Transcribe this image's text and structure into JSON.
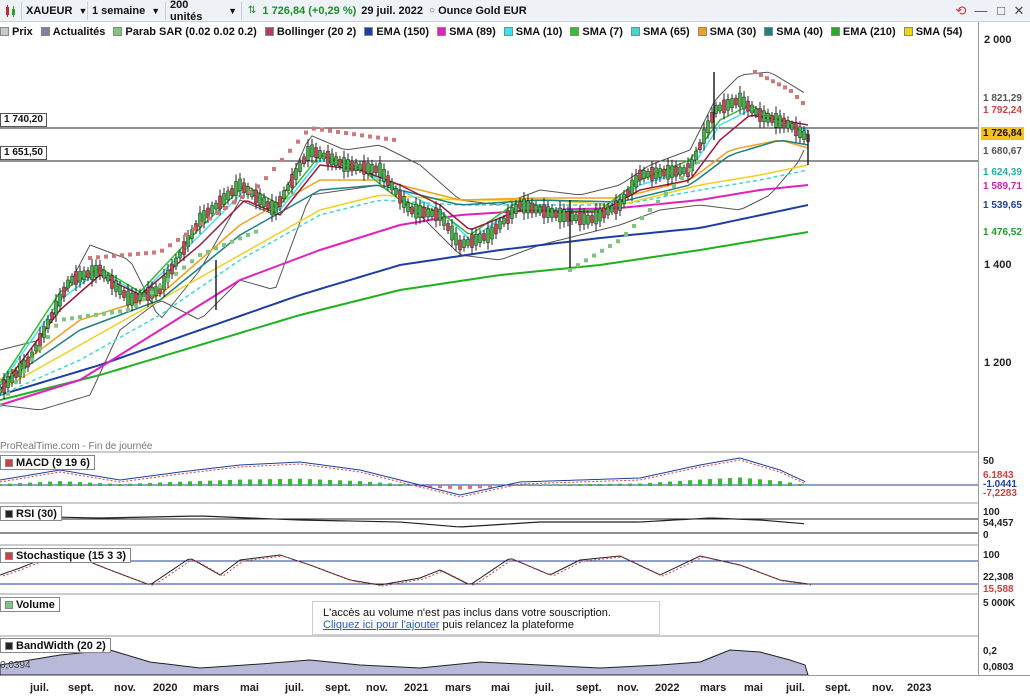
{
  "toolbar": {
    "symbol": "XAUEUR",
    "period": "1 semaine",
    "units": "200 unités",
    "price": "1 726,84 (+0,29 %)",
    "date": "29 juil. 2022",
    "instrument": "Ounce Gold EUR"
  },
  "legend": [
    {
      "label": "Prix",
      "color": "#c8c8c8"
    },
    {
      "label": "Actualités",
      "color": "#8080a0"
    },
    {
      "label": "Parab SAR (0.02 0.02 0.2)",
      "color": "#7fc47f"
    },
    {
      "label": "Bollinger (20 2)",
      "color": "#b04060"
    },
    {
      "label": "EMA (150)",
      "color": "#1f3fa0"
    },
    {
      "label": "SMA (89)",
      "color": "#e020c0"
    },
    {
      "label": "SMA (10)",
      "color": "#40e0f0"
    },
    {
      "label": "SMA (7)",
      "color": "#30c030"
    },
    {
      "label": "SMA (65)",
      "color": "#40d8d0"
    },
    {
      "label": "SMA (30)",
      "color": "#f0a020"
    },
    {
      "label": "SMA (40)",
      "color": "#208080"
    },
    {
      "label": "EMA (210)",
      "color": "#20b020"
    },
    {
      "label": "SMA (54)",
      "color": "#f0d020"
    }
  ],
  "price_axis": {
    "ticks": [
      "2 000",
      "1 400",
      "1 200"
    ],
    "flags": [
      {
        "text": "1 821,29",
        "color": "#555555"
      },
      {
        "text": "1 792,24",
        "color": "#d04040"
      },
      {
        "text": "1 726,84",
        "color": "#111111",
        "bg": "#f5c020"
      },
      {
        "text": "1 680,67",
        "color": "#555555"
      },
      {
        "text": "1 624,39",
        "color": "#20b0a0"
      },
      {
        "text": "1 589,71",
        "color": "#d020b0"
      },
      {
        "text": "1 539,65",
        "color": "#1f3fa0"
      },
      {
        "text": "1 476,52",
        "color": "#20a020"
      }
    ],
    "hlines": [
      "1 740,20",
      "1 651,50"
    ]
  },
  "watermark": "ProRealTime.com - Fin de journée",
  "panels": {
    "macd": {
      "title": "MACD (9 19 6)",
      "ticks": [
        "50",
        "6,1843",
        "-1,0441",
        "-7,2283"
      ]
    },
    "rsi": {
      "title": "RSI (30)",
      "ticks": [
        "100",
        "54,457",
        "0"
      ]
    },
    "stoch": {
      "title": "Stochastique (15 3 3)",
      "ticks": [
        "100",
        "22,308",
        "15,588"
      ]
    },
    "volume": {
      "title": "Volume",
      "ticks": [
        "5 000K"
      ]
    },
    "bandwidth": {
      "title": "BandWidth (20 2)",
      "ticks": [
        "0,2",
        "0,0803"
      ],
      "left_value": "0,0394"
    }
  },
  "notice": {
    "line1": "L'accès au volume n'est pas inclus dans votre souscription.",
    "link": "Cliquez ici pour l'ajouter",
    "line2_rest": " puis relancez la plateforme"
  },
  "xaxis": [
    "juil.",
    "sept.",
    "nov.",
    "2020",
    "mars",
    "mai",
    "juil.",
    "sept.",
    "nov.",
    "2021",
    "mars",
    "mai",
    "juil.",
    "sept.",
    "nov.",
    "2022",
    "mars",
    "mai",
    "juil.",
    "sept.",
    "nov.",
    "2023"
  ]
}
